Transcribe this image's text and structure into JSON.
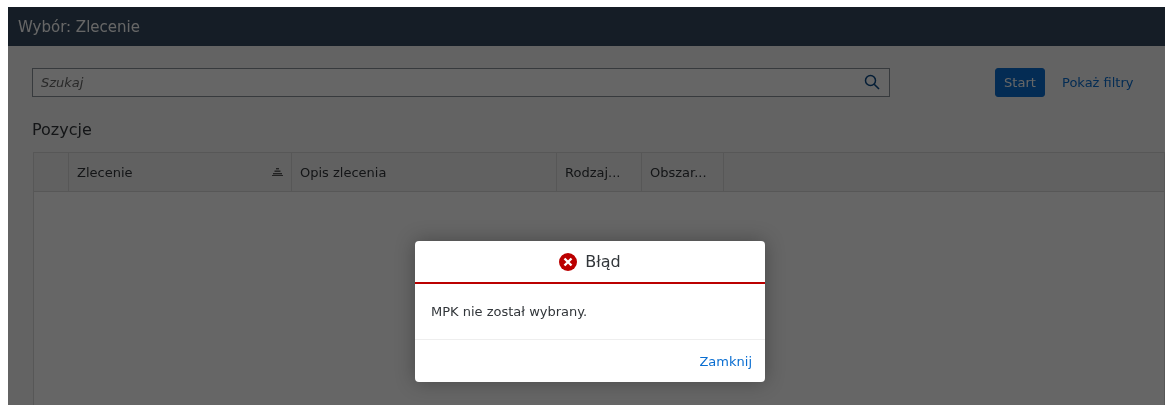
{
  "window": {
    "title": "Wybór: Zlecenie"
  },
  "search": {
    "placeholder": "Szukaj"
  },
  "start_button": "Start",
  "filters_link": "Pokaż filtry",
  "section_title": "Pozycje",
  "table": {
    "columns": [
      {
        "label": "Zlecenie",
        "sorted": true
      },
      {
        "label": "Opis zlecenia",
        "sorted": false
      },
      {
        "label": "Rodzaj...",
        "sorted": false
      },
      {
        "label": "Obszar...",
        "sorted": false
      }
    ]
  },
  "dialog": {
    "title": "Błąd",
    "message": "MPK nie został wybrany.",
    "close": "Zamknij"
  }
}
